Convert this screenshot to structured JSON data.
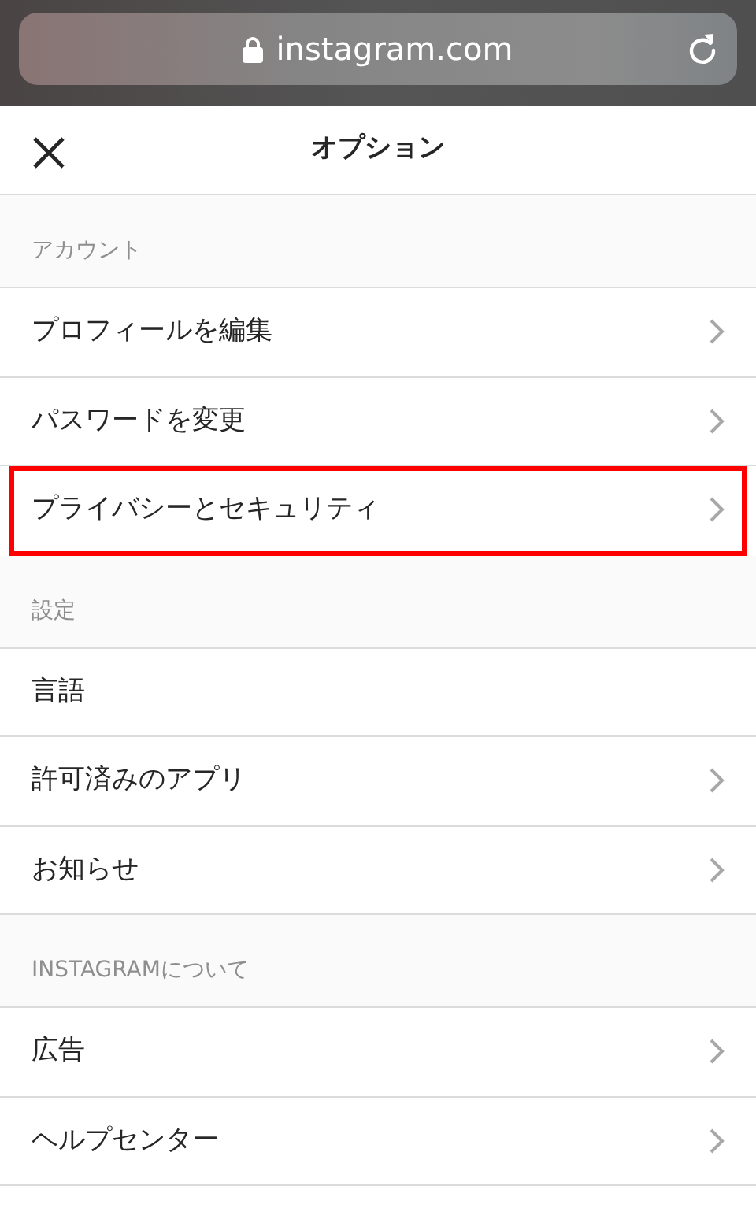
{
  "browser_bar": {
    "url": "instagram.com"
  },
  "header": {
    "title": "オプション"
  },
  "sections": [
    {
      "title": "アカウント",
      "items": [
        {
          "label": "プロフィールを編集",
          "chevron": true,
          "highlighted": false
        },
        {
          "label": "パスワードを変更",
          "chevron": true,
          "highlighted": false
        },
        {
          "label": "プライバシーとセキュリティ",
          "chevron": true,
          "highlighted": true
        }
      ]
    },
    {
      "title": "設定",
      "items": [
        {
          "label": "言語",
          "chevron": false,
          "highlighted": false
        },
        {
          "label": "許可済みのアプリ",
          "chevron": true,
          "highlighted": false
        },
        {
          "label": "お知らせ",
          "chevron": true,
          "highlighted": false
        }
      ]
    },
    {
      "title": "INSTAGRAMについて",
      "items": [
        {
          "label": "広告",
          "chevron": true,
          "highlighted": false
        },
        {
          "label": "ヘルプセンター",
          "chevron": true,
          "highlighted": false
        }
      ]
    }
  ]
}
